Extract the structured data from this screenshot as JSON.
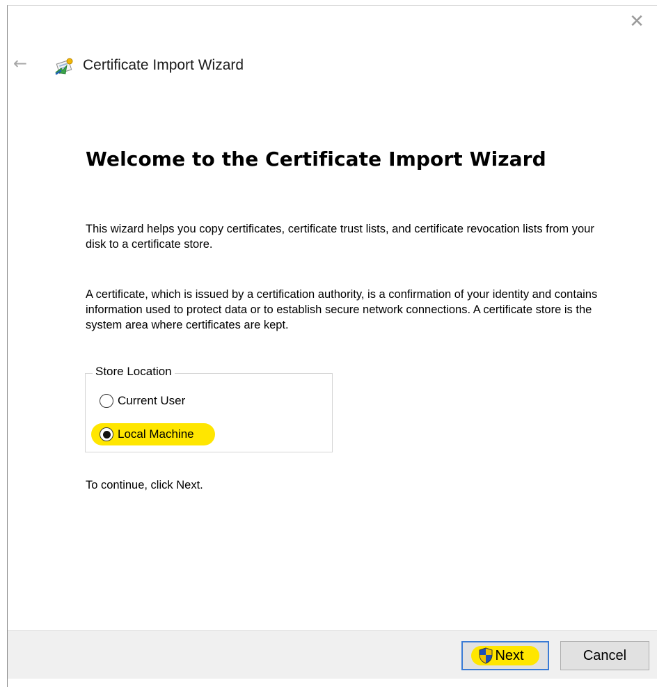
{
  "window": {
    "title": "Certificate Import Wizard",
    "close_glyph": "✕",
    "back_glyph": "←"
  },
  "content": {
    "heading": "Welcome to the Certificate Import Wizard",
    "paragraph1": "This wizard helps you copy certificates, certificate trust lists, and certificate revocation lists from your disk to a certificate store.",
    "paragraph2": "A certificate, which is issued by a certification authority, is a confirmation of your identity and contains information used to protect data or to establish secure network connections. A certificate store is the system area where certificates are kept.",
    "store_location": {
      "label": "Store Location",
      "options": [
        {
          "label": "Current User",
          "selected": false
        },
        {
          "label": "Local Machine",
          "selected": true
        }
      ]
    },
    "continue_hint": "To continue, click Next."
  },
  "footer": {
    "next_label": "Next",
    "cancel_label": "Cancel"
  },
  "colors": {
    "highlight": "#ffe600",
    "focus_border": "#3a7bd5",
    "footer_bg": "#f0f0f0"
  },
  "icons": {
    "wizard": "certificate-wizard-icon",
    "next": "uac-shield-icon"
  }
}
